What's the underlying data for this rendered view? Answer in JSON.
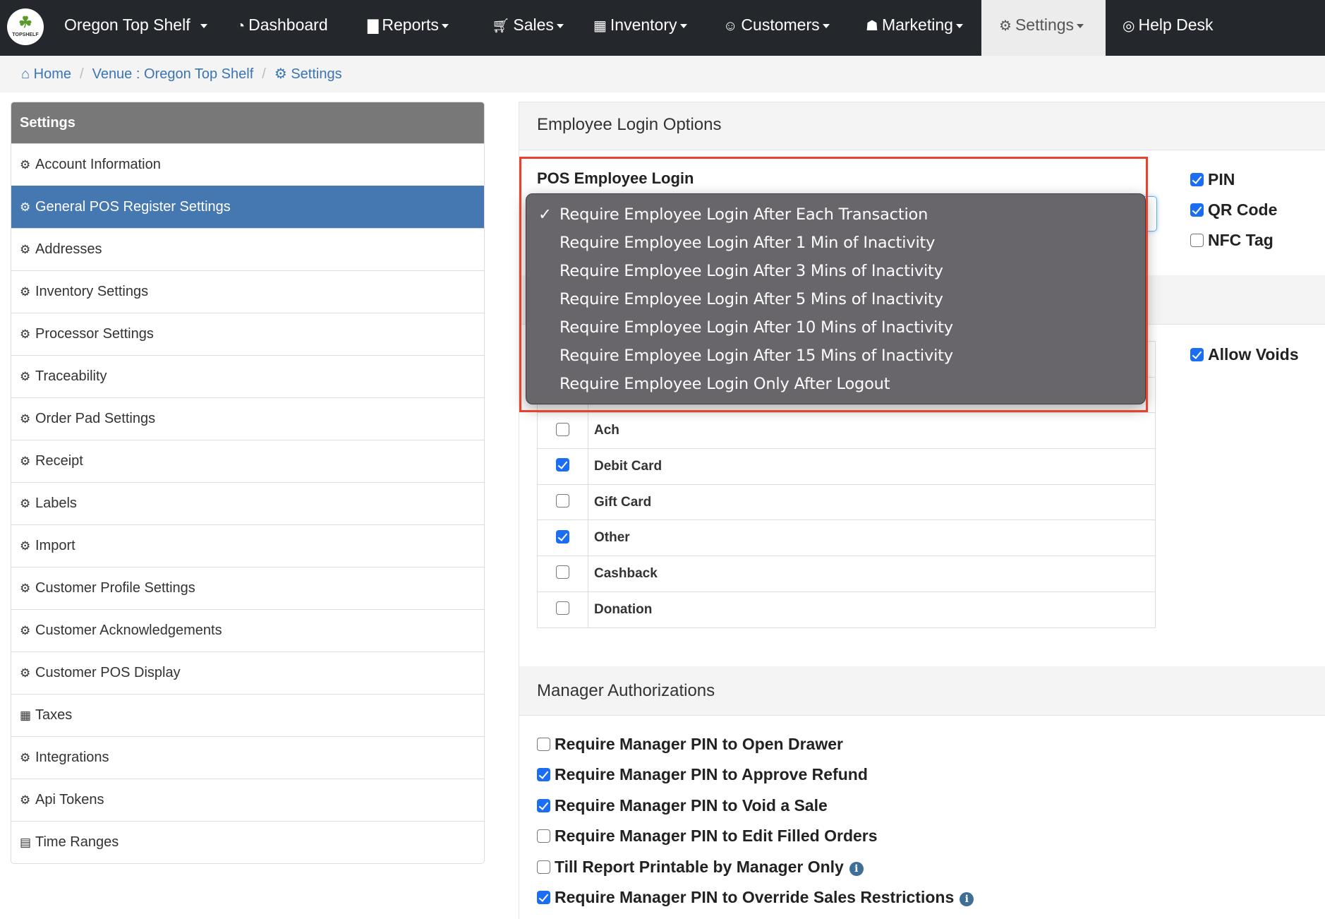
{
  "nav": {
    "brand": "Oregon Top Shelf",
    "logo_text": "TOPSHELF",
    "items": [
      {
        "label": "Dashboard",
        "icon": "dashboard-icon",
        "caret": false
      },
      {
        "label": "Reports",
        "icon": "bar-chart-icon",
        "caret": true
      },
      {
        "label": "Sales",
        "icon": "cart-icon",
        "caret": true
      },
      {
        "label": "Inventory",
        "icon": "grid-icon",
        "caret": true
      },
      {
        "label": "Customers",
        "icon": "user-circle-icon",
        "caret": true
      },
      {
        "label": "Marketing",
        "icon": "gift-icon",
        "caret": true
      },
      {
        "label": "Settings",
        "icon": "gears-icon",
        "caret": true,
        "active": true
      },
      {
        "label": "Help Desk",
        "icon": "life-ring-icon",
        "caret": false
      }
    ]
  },
  "breadcrumb": [
    "Home",
    "Venue : Oregon Top Shelf",
    "Settings"
  ],
  "sidebar": {
    "title": "Settings",
    "items": [
      {
        "label": "Account Information",
        "icon": "gears-icon"
      },
      {
        "label": "General POS Register Settings",
        "icon": "gears-icon",
        "active": true
      },
      {
        "label": "Addresses",
        "icon": "gears-icon"
      },
      {
        "label": "Inventory Settings",
        "icon": "gears-icon"
      },
      {
        "label": "Processor Settings",
        "icon": "gears-icon"
      },
      {
        "label": "Traceability",
        "icon": "gears-icon"
      },
      {
        "label": "Order Pad Settings",
        "icon": "gears-icon"
      },
      {
        "label": "Receipt",
        "icon": "gears-icon"
      },
      {
        "label": "Labels",
        "icon": "gears-icon"
      },
      {
        "label": "Import",
        "icon": "gears-icon"
      },
      {
        "label": "Customer Profile Settings",
        "icon": "gears-icon"
      },
      {
        "label": "Customer Acknowledgements",
        "icon": "gears-icon"
      },
      {
        "label": "Customer POS Display",
        "icon": "gears-icon"
      },
      {
        "label": "Taxes",
        "icon": "calculator-icon"
      },
      {
        "label": "Integrations",
        "icon": "gear-icon"
      },
      {
        "label": "Api Tokens",
        "icon": "gear-icon"
      },
      {
        "label": "Time Ranges",
        "icon": "calendar-icon"
      }
    ]
  },
  "employee_login": {
    "title": "Employee Login Options",
    "pos_login_label": "POS Employee Login",
    "methods": [
      {
        "label": "PIN",
        "checked": true
      },
      {
        "label": "QR Code",
        "checked": true
      },
      {
        "label": "NFC Tag",
        "checked": false
      }
    ],
    "dropdown_options": [
      "Require Employee Login After Each Transaction",
      "Require Employee Login After 1 Min of Inactivity",
      "Require Employee Login After 3 Mins of Inactivity",
      "Require Employee Login After 5 Mins of Inactivity",
      "Require Employee Login After 10 Mins of Inactivity",
      "Require Employee Login After 15 Mins of Inactivity",
      "Require Employee Login Only After Logout"
    ],
    "selected_index": 0
  },
  "payments": {
    "allow_voids": {
      "label": "Allow Voids",
      "checked": true
    },
    "rows": [
      {
        "label": "Ach",
        "checked": false
      },
      {
        "label": "Debit Card",
        "checked": true
      },
      {
        "label": "Gift Card",
        "checked": false
      },
      {
        "label": "Other",
        "checked": true
      },
      {
        "label": "Cashback",
        "checked": false
      },
      {
        "label": "Donation",
        "checked": false
      }
    ]
  },
  "manager": {
    "title": "Manager Authorizations",
    "items": [
      {
        "label": "Require Manager PIN to Open Drawer",
        "checked": false,
        "info": false
      },
      {
        "label": "Require Manager PIN to Approve Refund",
        "checked": true,
        "info": false
      },
      {
        "label": "Require Manager PIN to Void a Sale",
        "checked": true,
        "info": false
      },
      {
        "label": "Require Manager PIN to Edit Filled Orders",
        "checked": false,
        "info": false
      },
      {
        "label": "Till Report Printable by Manager Only",
        "checked": false,
        "info": true
      },
      {
        "label": "Require Manager PIN to Override Sales Restrictions",
        "checked": true,
        "info": true
      }
    ]
  },
  "colors": {
    "nav_bg": "#24272c",
    "active_blue": "#4577b0",
    "highlight_red": "#e8412c",
    "checkbox_blue": "#1b6ef3"
  }
}
